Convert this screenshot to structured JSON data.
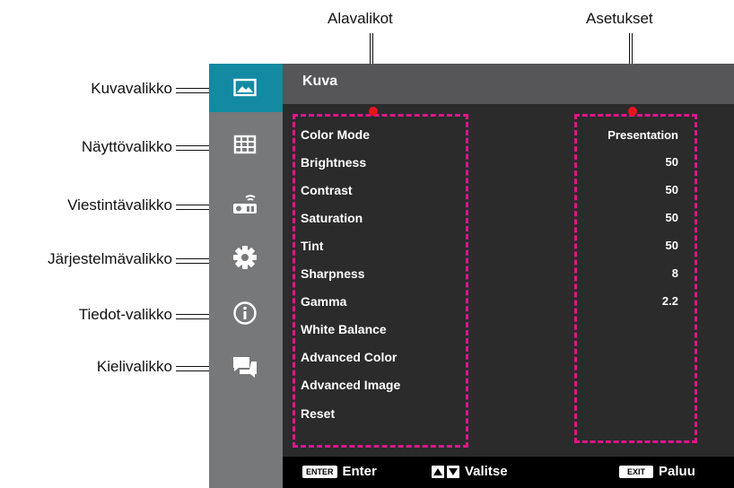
{
  "annotations": {
    "submenus_label": "Alavalikot",
    "settings_label": "Asetukset",
    "callouts": [
      {
        "label": "Kuvavalikko",
        "icon": "image-icon"
      },
      {
        "label": "Näyttövalikko",
        "icon": "display-grid-icon"
      },
      {
        "label": "Viestintävalikko",
        "icon": "projector-wifi-icon"
      },
      {
        "label": "Järjestelmävalikko",
        "icon": "gear-icon"
      },
      {
        "label": "Tiedot-valikko",
        "icon": "info-icon"
      },
      {
        "label": "Kielivalikko",
        "icon": "chat-bubbles-icon"
      }
    ]
  },
  "osd": {
    "title": "Kuva",
    "items": [
      {
        "label": "Color Mode",
        "value": "Presentation"
      },
      {
        "label": "Brightness",
        "value": "50"
      },
      {
        "label": "Contrast",
        "value": "50"
      },
      {
        "label": "Saturation",
        "value": "50"
      },
      {
        "label": "Tint",
        "value": "50"
      },
      {
        "label": "Sharpness",
        "value": "8"
      },
      {
        "label": "Gamma",
        "value": "2.2"
      },
      {
        "label": "White Balance",
        "value": ""
      },
      {
        "label": "Advanced Color",
        "value": ""
      },
      {
        "label": "Advanced Image",
        "value": ""
      },
      {
        "label": "Reset",
        "value": ""
      }
    ],
    "footer": {
      "enter_key": "ENTER",
      "enter_label": "Enter",
      "select_label": "Valitse",
      "exit_key": "EXIT",
      "exit_label": "Paluu"
    }
  },
  "colors": {
    "sidebar": "#77787a",
    "active_tab": "#138aa2",
    "header": "#565658",
    "content": "#2b2b2c",
    "footer": "#000000",
    "annotation_box": "#e0158a",
    "callout_dot": "#e8141c"
  }
}
